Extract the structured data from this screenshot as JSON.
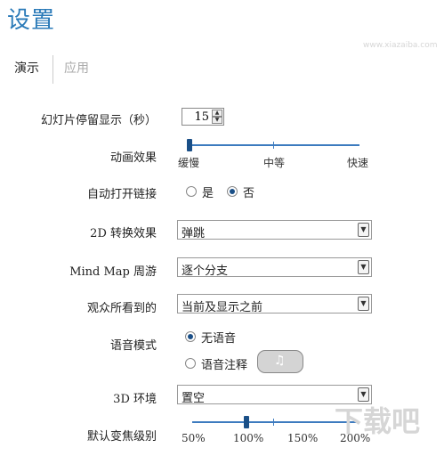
{
  "title": "设置",
  "tabs": {
    "active": "演示",
    "inactive": "应用"
  },
  "slide_duration": {
    "label": "幻灯片停留显示（秒）",
    "value": "15"
  },
  "animation": {
    "label": "动画效果",
    "level": 0.0,
    "ticks": [
      "缓慢",
      "中等",
      "快速"
    ]
  },
  "auto_open_links": {
    "label": "自动打开链接",
    "options": [
      "是",
      "否"
    ],
    "selected": "否"
  },
  "transition_2d": {
    "label": "2D 转换效果",
    "value": "弹跳"
  },
  "mindmap_tour": {
    "label": "Mind Map 周游",
    "value": "逐个分支"
  },
  "audience_view": {
    "label": "观众所看到的",
    "value": "当前及显示之前"
  },
  "voice_mode": {
    "label": "语音模式",
    "options": [
      "无语音",
      "语音注释"
    ],
    "selected": "无语音",
    "button_icon": "music-note-icon"
  },
  "env_3d": {
    "label": "3D 环境",
    "value": "置空"
  },
  "zoom": {
    "label": "默认变焦级别",
    "value_percent": 100,
    "ticks": [
      "50%",
      "100%",
      "150%",
      "200%"
    ]
  },
  "watermark": {
    "main": "下载吧",
    "url": "www.xiazaiba.com"
  }
}
